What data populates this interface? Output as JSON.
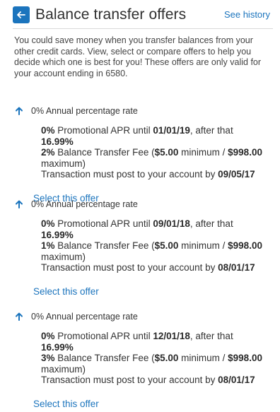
{
  "header": {
    "title": "Balance transfer offers",
    "history_link": "See history",
    "back_icon": "back-arrow-icon"
  },
  "intro": "You could save money when you transfer balances from your other credit cards. View, select or compare offers to help you decide which one is best for you! These offers are only valid for your account ending in 6580.",
  "colors": {
    "accent": "#1b74bd",
    "text": "#333333"
  },
  "offers": [
    {
      "rate_label": "0% Annual percentage rate",
      "promo_rate": "0%",
      "promo_text": " Promotional APR until ",
      "promo_date": "01/01/19",
      "after_text": ", after that ",
      "after_rate": "16.99%",
      "fee_rate": "2%",
      "fee_text": " Balance Transfer Fee (",
      "fee_min": "$5.00",
      "fee_min_text": " minimum / ",
      "fee_max": "$998.00",
      "fee_max_text": " maximum)",
      "post_text": "Transaction must post to your account by ",
      "post_date": "09/05/17",
      "select_label": "Select this offer"
    },
    {
      "rate_label": "0% Annual percentage rate",
      "promo_rate": "0%",
      "promo_text": " Promotional APR until ",
      "promo_date": "09/01/18",
      "after_text": ", after that ",
      "after_rate": "16.99%",
      "fee_rate": "1%",
      "fee_text": " Balance Transfer Fee (",
      "fee_min": "$5.00",
      "fee_min_text": " minimum / ",
      "fee_max": "$998.00",
      "fee_max_text": " maximum)",
      "post_text": "Transaction must post to your account by ",
      "post_date": "08/01/17",
      "select_label": "Select this offer"
    },
    {
      "rate_label": "0% Annual percentage rate",
      "promo_rate": "0%",
      "promo_text": " Promotional APR until ",
      "promo_date": "12/01/18",
      "after_text": ", after that ",
      "after_rate": "16.99%",
      "fee_rate": "3%",
      "fee_text": " Balance Transfer Fee (",
      "fee_min": "$5.00",
      "fee_min_text": " minimum / ",
      "fee_max": "$998.00",
      "fee_max_text": " maximum)",
      "post_text": "Transaction must post to your account by ",
      "post_date": "08/01/17",
      "select_label": "Select this offer"
    }
  ]
}
